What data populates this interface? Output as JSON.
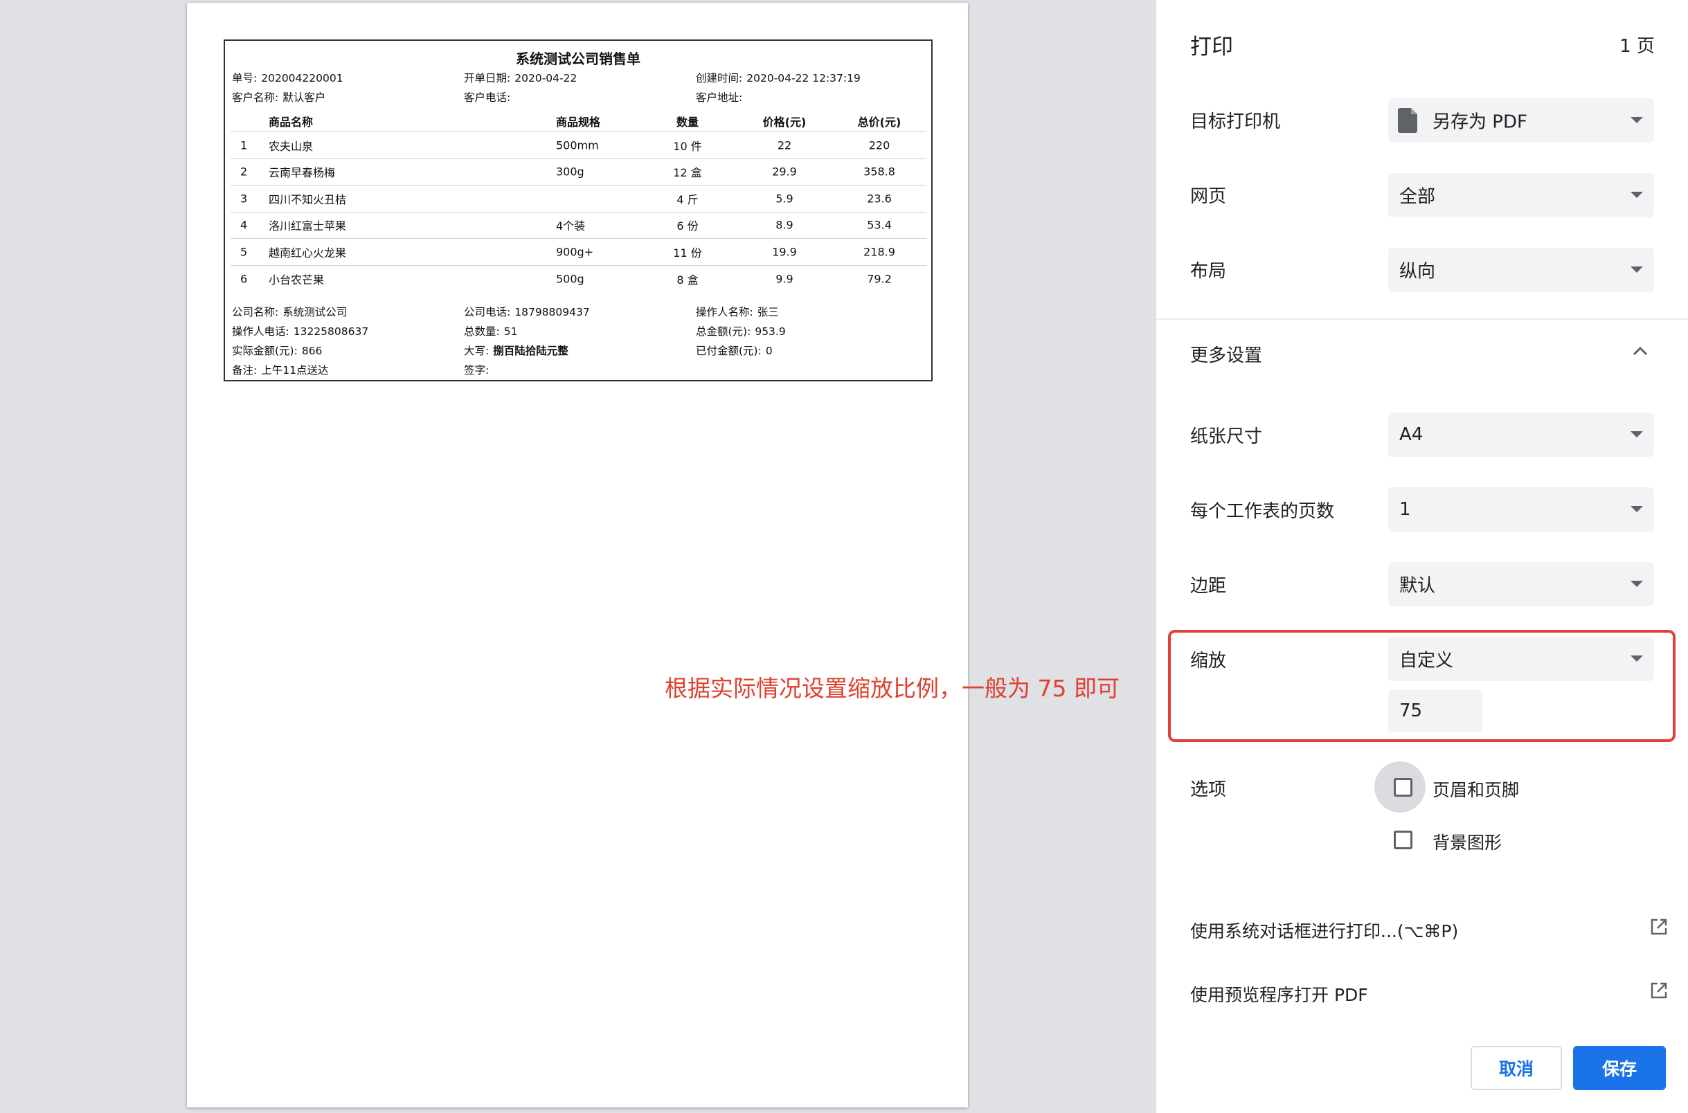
{
  "receipt": {
    "title": "系统测试公司销售单",
    "order_no_label": "单号:",
    "order_no": "202004220001",
    "open_date_label": "开单日期:",
    "open_date": "2020-04-22",
    "created_label": "创建时间:",
    "created": "2020-04-22 12:37:19",
    "customer_name_label": "客户名称:",
    "customer_name": "默认客户",
    "customer_phone_label": "客户电话:",
    "customer_phone": "",
    "customer_addr_label": "客户地址:",
    "customer_addr": "",
    "columns": [
      "商品名称",
      "商品规格",
      "数量",
      "价格(元)",
      "总价(元)"
    ],
    "rows": [
      {
        "idx": "1",
        "name": "农夫山泉",
        "spec": "500mm",
        "qty": "10 件",
        "price": "22",
        "total": "220"
      },
      {
        "idx": "2",
        "name": "云南早春杨梅",
        "spec": "300g",
        "qty": "12 盒",
        "price": "29.9",
        "total": "358.8"
      },
      {
        "idx": "3",
        "name": "四川不知火丑桔",
        "spec": "",
        "qty": "4 斤",
        "price": "5.9",
        "total": "23.6"
      },
      {
        "idx": "4",
        "name": "洛川红富士苹果",
        "spec": "4个装",
        "qty": "6 份",
        "price": "8.9",
        "total": "53.4"
      },
      {
        "idx": "5",
        "name": "越南红心火龙果",
        "spec": "900g+",
        "qty": "11 份",
        "price": "19.9",
        "total": "218.9"
      },
      {
        "idx": "6",
        "name": "小台农芒果",
        "spec": "500g",
        "qty": "8 盒",
        "price": "9.9",
        "total": "79.2"
      }
    ],
    "company_name_label": "公司名称:",
    "company_name": "系统测试公司",
    "company_phone_label": "公司电话:",
    "company_phone": "18798809437",
    "operator_label": "操作人名称:",
    "operator": "张三",
    "operator_phone_label": "操作人电话:",
    "operator_phone": "13225808637",
    "total_qty_label": "总数量:",
    "total_qty": "51",
    "total_amount_label": "总金额(元):",
    "total_amount": "953.9",
    "actual_amount_label": "实际金额(元):",
    "actual_amount": "866",
    "capital_label": "大写:",
    "capital": "捌百陆拾陆元整",
    "paid_label": "已付金额(元):",
    "paid": "0",
    "remark_label": "备注:",
    "remark": "上午11点送达",
    "sign_label": "签字:",
    "sign": ""
  },
  "annotation": "根据实际情况设置缩放比例，一般为 75 即可",
  "panel": {
    "title": "打印",
    "page_count": "1 页",
    "destination_label": "目标打印机",
    "destination_value": "另存为 PDF",
    "pages_label": "网页",
    "pages_value": "全部",
    "layout_label": "布局",
    "layout_value": "纵向",
    "more_settings_label": "更多设置",
    "paper_size_label": "纸张尺寸",
    "paper_size_value": "A4",
    "pages_per_sheet_label": "每个工作表的页数",
    "pages_per_sheet_value": "1",
    "margins_label": "边距",
    "margins_value": "默认",
    "scale_label": "缩放",
    "scale_value": "自定义",
    "scale_input": "75",
    "options_label": "选项",
    "opt_headers": "页眉和页脚",
    "opt_background": "背景图形",
    "system_dialog_link": "使用系统对话框进行打印...(⌥⌘P)",
    "open_preview_link": "使用预览程序打开 PDF",
    "cancel": "取消",
    "save": "保存"
  },
  "colors": {
    "accent": "#1a73e8",
    "annotation": "#e0402e",
    "highlight_box": "#e0403a",
    "select_bg": "#f1f3f4"
  },
  "icons": [
    "pdf-document-icon",
    "caret-down-icon",
    "chevron-up-icon",
    "checkbox-icon",
    "external-link-icon"
  ]
}
